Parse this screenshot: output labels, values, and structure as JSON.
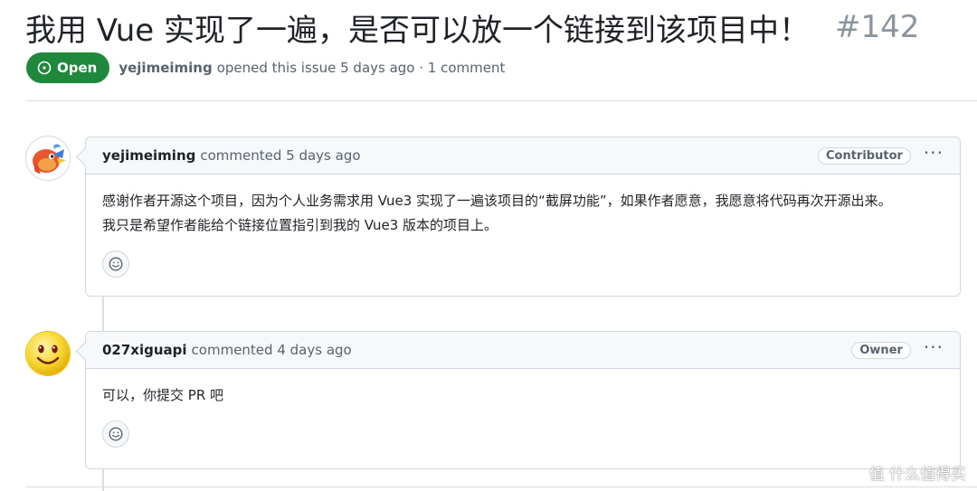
{
  "issue": {
    "title": "我用 Vue 实现了一遍，是否可以放一个链接到该项目中！",
    "number": "#142",
    "state": "Open",
    "author": "yejimeiming",
    "meta_text": "opened this issue 5 days ago · 1 comment"
  },
  "comments": [
    {
      "author": "yejimeiming",
      "action": "commented 5 days ago",
      "role": "Contributor",
      "body_lines": [
        "感谢作者开源这个项目，因为个人业务需求用 Vue3 实现了一遍该项目的“截屏功能”，如果作者愿意，我愿意将代码再次开源出来。",
        "我只是希望作者能给个链接位置指引到我的 Vue3 版本的项目上。"
      ],
      "avatar_icon": "bird-avatar-icon"
    },
    {
      "author": "027xiguapi",
      "action": "commented 4 days ago",
      "role": "Owner",
      "body_lines": [
        "可以，你提交 PR 吧"
      ],
      "avatar_icon": "smiley-avatar-icon"
    }
  ],
  "more_label": "···",
  "watermark": "值 什么值得买",
  "colors": {
    "open_green": "#1f883d",
    "muted": "#59636e",
    "border": "#d0d7de",
    "header_bg": "#f6f8fa"
  }
}
